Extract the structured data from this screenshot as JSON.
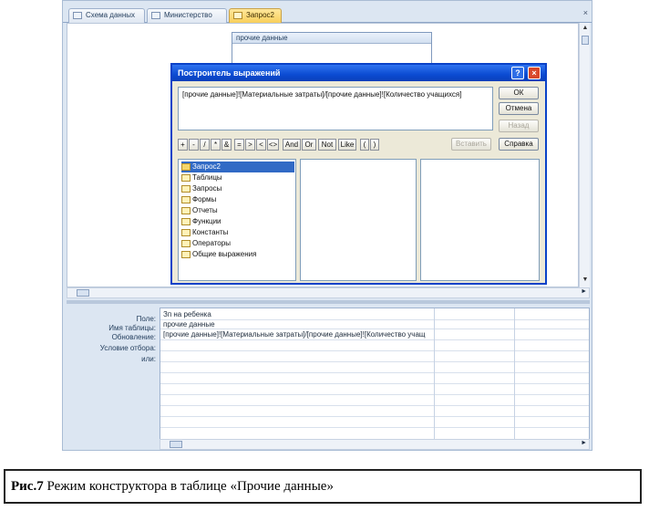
{
  "tabs": [
    {
      "label": "Схема данных"
    },
    {
      "label": "Министерство"
    },
    {
      "label": "Запрос2"
    }
  ],
  "table_box": {
    "title": "прочие данные"
  },
  "dialog": {
    "title": "Построитель выражений",
    "expression": "[прочие данные]![Материальные затраты]/[прочие данные]![Количество учащихся]",
    "buttons": {
      "ok": "ОК",
      "cancel": "Отмена",
      "undo": "Назад",
      "paste": "Вставить",
      "help": "Справка"
    },
    "operators": [
      "+",
      "-",
      "/",
      "*",
      "&",
      "=",
      ">",
      "<",
      "<>",
      "And",
      "Or",
      "Not",
      "Like",
      "(",
      ")"
    ],
    "tree": [
      "Запрос2",
      "Таблицы",
      "Запросы",
      "Формы",
      "Отчеты",
      "Функции",
      "Константы",
      "Операторы",
      "Общие выражения"
    ]
  },
  "grid": {
    "row_labels": [
      "Поле:",
      "Имя таблицы:",
      "Обновление:",
      "Условие отбора:",
      "или:"
    ],
    "cells": [
      "Зп на ребенка",
      "прочие данные",
      "[прочие данные]![Материальные затраты]/[прочие данные]![Количество учащ"
    ]
  },
  "caption": {
    "label": "Рис.7",
    "text": " Режим конструктора в таблице «Прочие данные»"
  }
}
